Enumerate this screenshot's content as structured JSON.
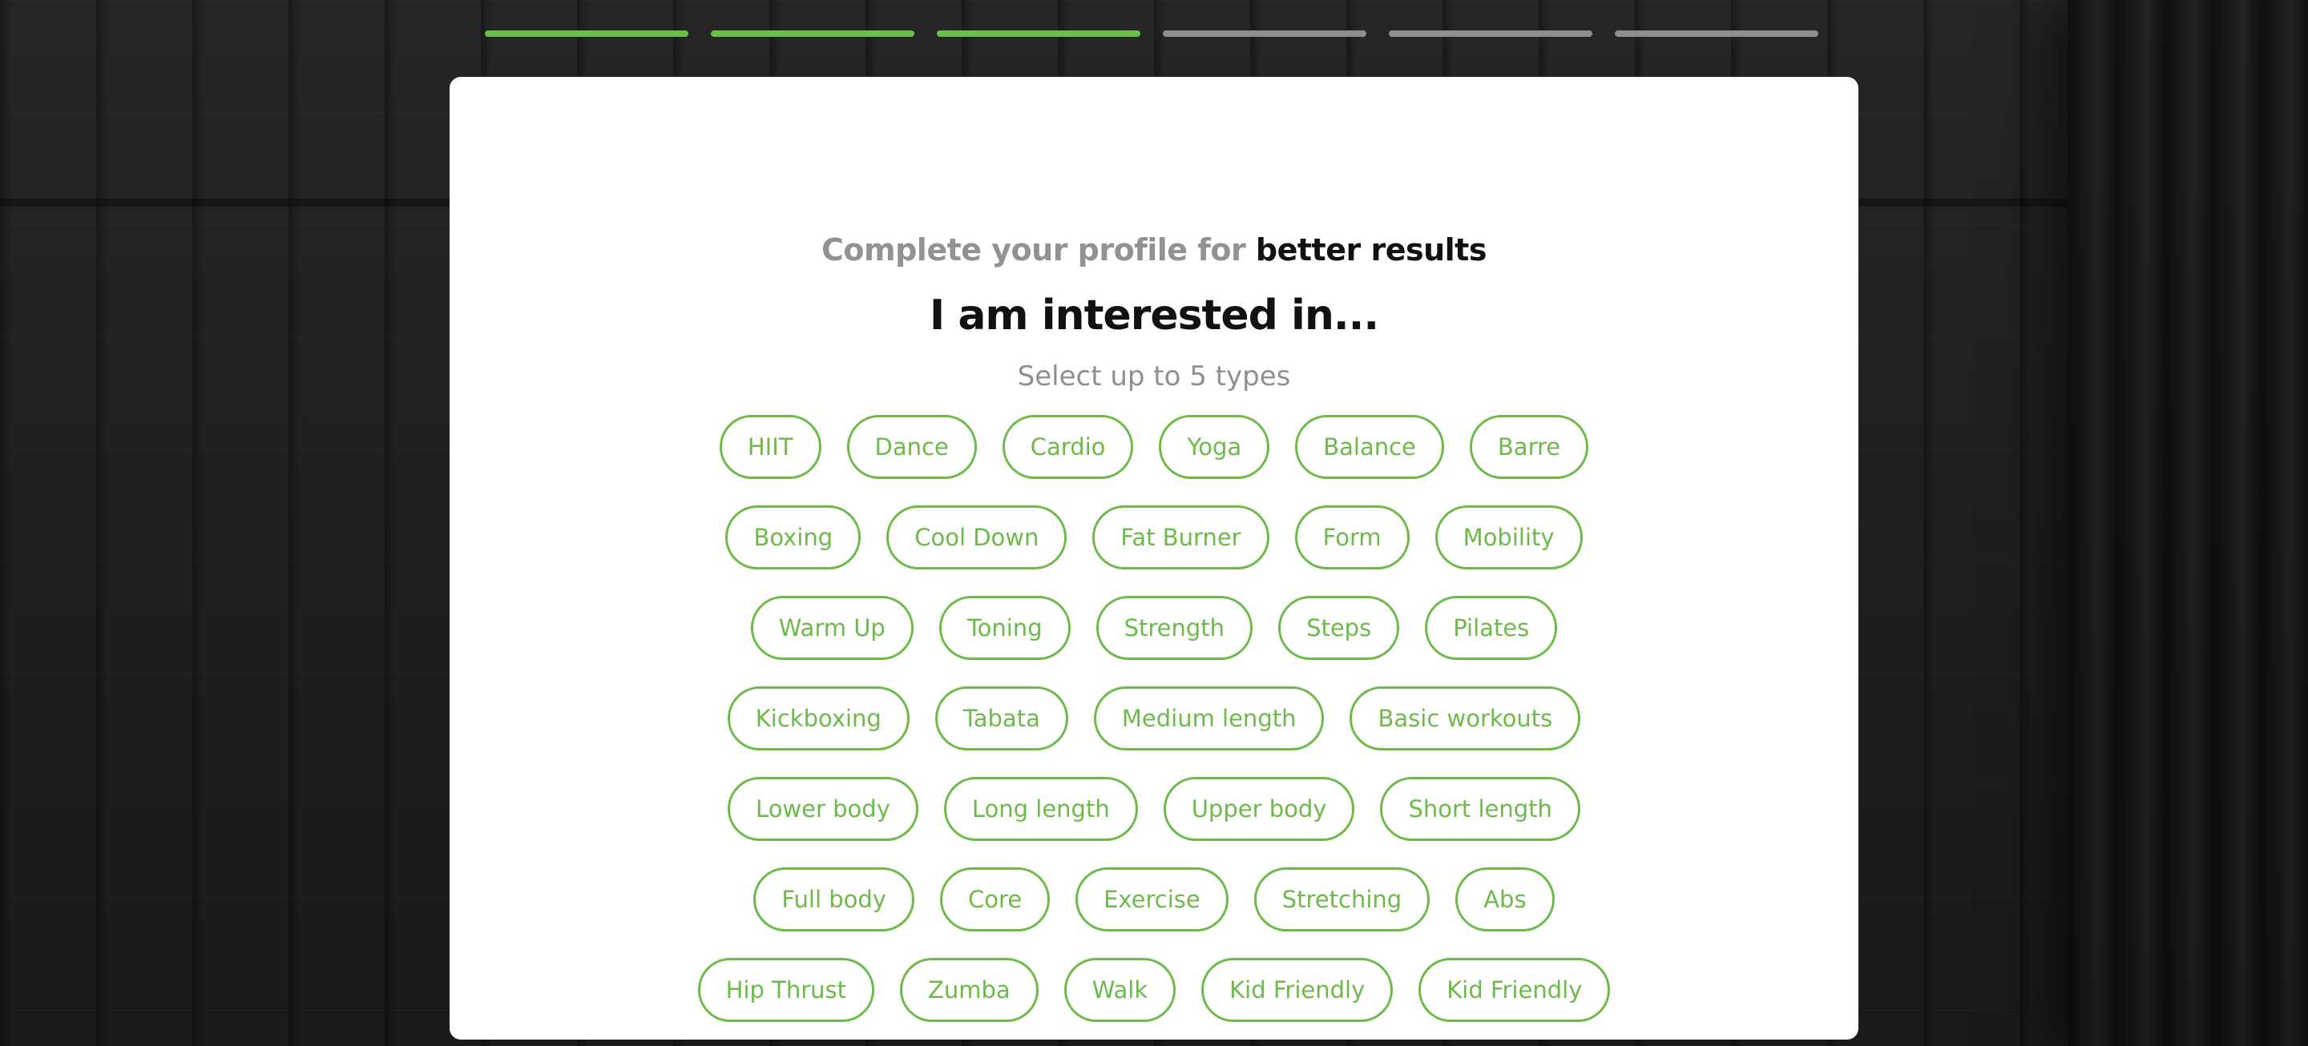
{
  "progress": {
    "total_steps": 6,
    "completed_steps": 3,
    "done_color": "#6cc04a",
    "pending_color": "#8e8e8e"
  },
  "header": {
    "subtitle_muted": "Complete your profile for",
    "subtitle_strong": "better results",
    "title": "I am interested in...",
    "hint": "Select up to 5 types"
  },
  "accent_color": "#6cbb48",
  "chip_rows": [
    [
      "HIIT",
      "Dance",
      "Cardio",
      "Yoga",
      "Balance",
      "Barre"
    ],
    [
      "Boxing",
      "Cool Down",
      "Fat Burner",
      "Form",
      "Mobility"
    ],
    [
      "Warm Up",
      "Toning",
      "Strength",
      "Steps",
      "Pilates"
    ],
    [
      "Kickboxing",
      "Tabata",
      "Medium length",
      "Basic workouts"
    ],
    [
      "Lower body",
      "Long length",
      "Upper body",
      "Short length"
    ],
    [
      "Full body",
      "Core",
      "Exercise",
      "Stretching",
      "Abs"
    ],
    [
      "Hip Thrust",
      "Zumba",
      "Walk",
      "Kid Friendly",
      "Kid Friendly"
    ]
  ]
}
